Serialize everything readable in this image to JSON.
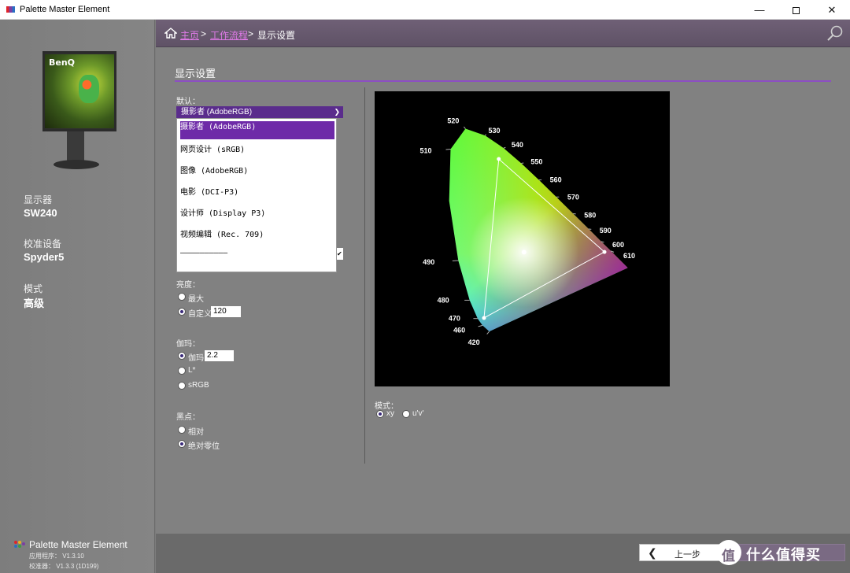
{
  "window": {
    "title": "Palette Master Element",
    "minimize_glyph": "—",
    "close_glyph": "✕"
  },
  "sidebar": {
    "monitor_brand": "BenQ",
    "items": [
      {
        "label": "显示器",
        "value": "SW240"
      },
      {
        "label": "校准设备",
        "value": "Spyder5"
      },
      {
        "label": "模式",
        "value": "高级"
      }
    ],
    "app_name": "Palette Master Element",
    "app_version": "应用程序：  V1.3.10",
    "calibrator_version": "校准器：  V1.3.3 (1D199)"
  },
  "header": {
    "breadcrumb": [
      "主页",
      "工作流程",
      "显示设置"
    ],
    "separator": ">"
  },
  "main": {
    "title": "显示设置",
    "preset_label": "默认：",
    "preset_selected": "摄影者 (AdobeRGB)",
    "preset_options": [
      "摄影者 (AdobeRGB)",
      "网页设计 (sRGB)",
      "图像 (AdobeRGB)",
      "电影 (DCI-P3)",
      "设计师 (Display P3)",
      "视频编辑 (Rec. 709)",
      "——————————"
    ],
    "brightness": {
      "label": "亮度：",
      "options": [
        "最大",
        "自定义"
      ],
      "selected": "自定义",
      "custom_value": "120"
    },
    "gamma": {
      "label": "伽玛：",
      "options": [
        "伽玛",
        "L*",
        "sRGB"
      ],
      "selected": "伽玛",
      "value": "2.2"
    },
    "black_point": {
      "label": "黑点：",
      "options": [
        "相对",
        "绝对零位"
      ],
      "selected": "绝对零位"
    },
    "chart_mode": {
      "label": "模式：",
      "options": [
        "xy",
        "u'v'"
      ],
      "selected": "xy"
    }
  },
  "chart_data": {
    "type": "scatter",
    "title": "",
    "xlabel": "",
    "ylabel": "",
    "wavelength_labels": [
      "420",
      "460",
      "470",
      "480",
      "490",
      "510",
      "520",
      "530",
      "540",
      "550",
      "560",
      "570",
      "580",
      "590",
      "600",
      "610"
    ],
    "gamut_triangle": [
      {
        "name": "green",
        "x": 0.21,
        "y": 0.71
      },
      {
        "name": "red",
        "x": 0.64,
        "y": 0.33
      },
      {
        "name": "blue",
        "x": 0.15,
        "y": 0.06
      }
    ],
    "white_point": {
      "x": 0.3127,
      "y": 0.329
    },
    "colors": {
      "background": "#000000",
      "triangle": "#ffffff"
    }
  },
  "footer": {
    "prev_label": "上一步",
    "watermark_text": "什么值得买",
    "watermark_badge": "值"
  },
  "colors": {
    "accent": "#8d4ec4",
    "select_bg": "#5a2c8c",
    "link": "#e07ae8"
  }
}
